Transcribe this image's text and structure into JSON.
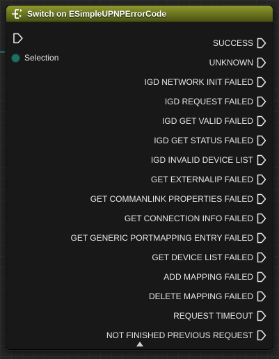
{
  "node": {
    "title": "Switch on ESimpleUPNPErrorCode",
    "header_color": "#7d8727",
    "input_pin": {
      "label": "Selection",
      "color": "#1f6e63"
    },
    "outputs": [
      "SUCCESS",
      "UNKNOWN",
      "IGD NETWORK INIT FAILED",
      "IGD REQUEST FAILED",
      "IGD GET VALID FAILED",
      "IGD GET STATUS FAILED",
      "IGD INVALID DEVICE LIST",
      "GET EXTERNALIP FAILED",
      "GET COMMANLINK PROPERTIES FAILED",
      "GET CONNECTION INFO FAILED",
      "GET GENERIC PORTMAPPING ENTRY FAILED",
      "GET DEVICE LIST FAILED",
      "ADD MAPPING FAILED",
      "DELETE MAPPING FAILED",
      "REQUEST TIMEOUT",
      "NOT FINISHED PREVIOUS REQUEST"
    ]
  }
}
